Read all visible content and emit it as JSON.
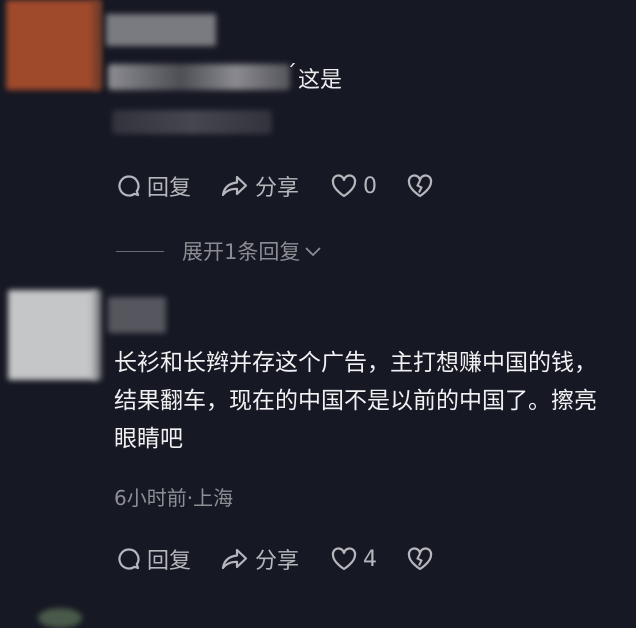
{
  "comments": [
    {
      "visible_text": "这是",
      "tick_mark": "ˊ",
      "actions": {
        "reply_label": "回复",
        "share_label": "分享",
        "like_count": "0"
      },
      "expand_label": "展开1条回复"
    },
    {
      "text": "长衫和长辫并存这个广告，主打想赚中国的钱，结果翻车，现在的中国不是以前的中国了。擦亮眼睛吧",
      "meta": "6小时前·上海",
      "actions": {
        "reply_label": "回复",
        "share_label": "分享",
        "like_count": "4"
      }
    }
  ],
  "icons": {
    "reply": "speech-bubble-icon",
    "share": "share-arrow-icon",
    "like": "heart-icon",
    "dislike": "broken-heart-icon",
    "expand": "chevron-down-icon"
  },
  "colors": {
    "background": "#161823",
    "text": "#ececee",
    "secondary": "#8e8f95"
  }
}
